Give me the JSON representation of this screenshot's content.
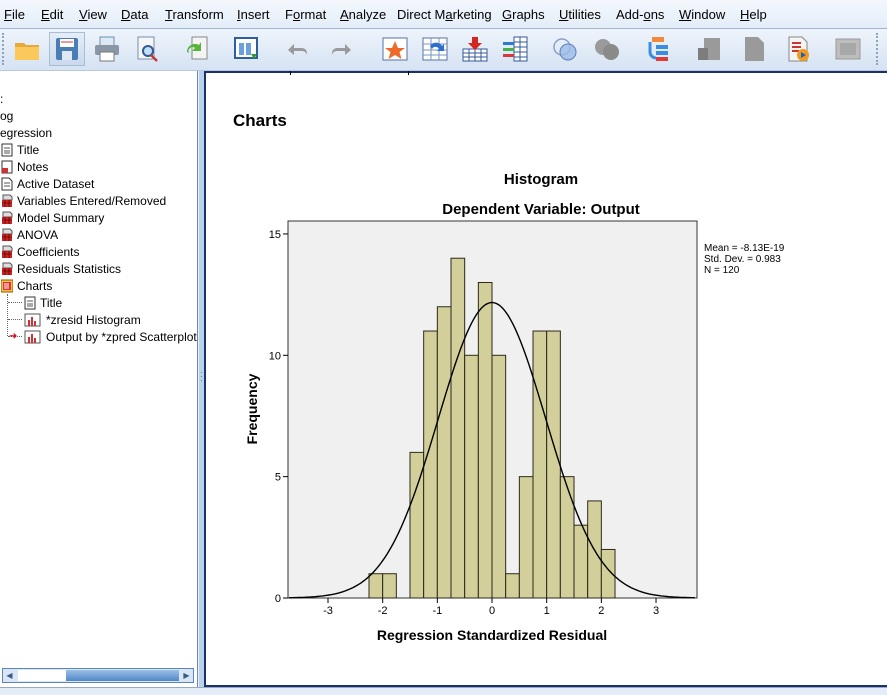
{
  "menu": [
    {
      "label": "File",
      "underline": 0
    },
    {
      "label": "Edit",
      "underline": 0
    },
    {
      "label": "View",
      "underline": 0
    },
    {
      "label": "Data",
      "underline": 0
    },
    {
      "label": "Transform",
      "underline": 0
    },
    {
      "label": "Insert",
      "underline": 0
    },
    {
      "label": "Format",
      "underline": 1
    },
    {
      "label": "Analyze",
      "underline": 0
    },
    {
      "label": "Direct Marketing",
      "underline": 8
    },
    {
      "label": "Graphs",
      "underline": 0
    },
    {
      "label": "Utilities",
      "underline": 0
    },
    {
      "label": "Add-ons",
      "underline": 4
    },
    {
      "label": "Window",
      "underline": 0
    },
    {
      "label": "Help",
      "underline": 0
    }
  ],
  "toolbar": [
    {
      "icon": "open-folder-icon",
      "enabled": true
    },
    {
      "icon": "save-icon",
      "enabled": true,
      "pressed": true
    },
    {
      "icon": "print-icon",
      "enabled": true
    },
    {
      "icon": "print-preview-icon",
      "enabled": true
    },
    {
      "icon": "export-icon",
      "enabled": true
    },
    {
      "icon": "recall-dialog-icon",
      "enabled": true
    },
    {
      "icon": "undo-icon",
      "enabled": false
    },
    {
      "icon": "redo-icon",
      "enabled": false
    },
    {
      "icon": "goto-case-icon",
      "enabled": true
    },
    {
      "icon": "goto-variable-icon",
      "enabled": true
    },
    {
      "icon": "insert-cases-icon",
      "enabled": true
    },
    {
      "icon": "variables-icon",
      "enabled": true
    },
    {
      "icon": "split-file-icon",
      "enabled": true
    },
    {
      "icon": "select-cases-icon",
      "enabled": false
    },
    {
      "icon": "outline-tree-icon",
      "enabled": true
    },
    {
      "icon": "promote-icon",
      "enabled": false
    },
    {
      "icon": "demote-icon",
      "enabled": false
    },
    {
      "icon": "run-script-icon",
      "enabled": true
    },
    {
      "icon": "show-hide-icon",
      "enabled": false
    }
  ],
  "outline": [
    {
      "label": ":",
      "indent": 0,
      "icon": "none"
    },
    {
      "label": "og",
      "indent": 0,
      "icon": "none"
    },
    {
      "label": "egression",
      "indent": 0,
      "icon": "none"
    },
    {
      "label": "Title",
      "indent": 1,
      "icon": "title-icon"
    },
    {
      "label": "Notes",
      "indent": 1,
      "icon": "notes-icon"
    },
    {
      "label": "Active Dataset",
      "indent": 1,
      "icon": "document-icon"
    },
    {
      "label": "Variables Entered/Removed",
      "indent": 1,
      "icon": "table-icon"
    },
    {
      "label": "Model Summary",
      "indent": 1,
      "icon": "table-icon"
    },
    {
      "label": "ANOVA",
      "indent": 1,
      "icon": "table-icon"
    },
    {
      "label": "Coefficients",
      "indent": 1,
      "icon": "table-icon"
    },
    {
      "label": "Residuals Statistics",
      "indent": 1,
      "icon": "table-icon"
    },
    {
      "label": "Charts",
      "indent": 1,
      "icon": "folder-open-icon"
    },
    {
      "label": "Title",
      "indent": 2,
      "icon": "title-icon"
    },
    {
      "label": "*zresid Histogram",
      "indent": 2,
      "icon": "chart-icon"
    },
    {
      "label": "Output by *zpred Scatterplot",
      "indent": 2,
      "icon": "chart-icon",
      "current": true
    }
  ],
  "output": {
    "heading": "Charts"
  },
  "chart_data": {
    "type": "bar",
    "title": "Histogram",
    "subtitle": "Dependent Variable: Output",
    "xlabel": "Regression Standardized Residual",
    "ylabel": "Frequency",
    "xlim": [
      -3.5,
      3.75
    ],
    "ylim": [
      0,
      15.5
    ],
    "xticks": [
      -3,
      -2,
      -1,
      0,
      1,
      2,
      3
    ],
    "yticks": [
      0,
      5,
      10,
      15
    ],
    "bin_width": 0.25,
    "bin_starts": [
      -2.25,
      -2.0,
      -1.75,
      -1.5,
      -1.25,
      -1.0,
      -0.75,
      -0.5,
      -0.25,
      0.0,
      0.25,
      0.5,
      0.75,
      1.0,
      1.25,
      1.5,
      1.75,
      2.0
    ],
    "values": [
      1,
      1,
      0,
      6,
      11,
      12,
      14,
      10,
      13,
      10,
      1,
      5,
      11,
      11,
      5,
      3,
      4,
      2
    ],
    "normal_curve": {
      "mean": -8.13e-19,
      "sd": 0.983,
      "n": 120
    },
    "stats_legend": [
      "Mean = -8.13E-19",
      "Std. Dev. = 0.983",
      "N = 120"
    ],
    "legend_position": "right",
    "bar_color": "#d3cf9a",
    "plot_bg": "#f0f0f0",
    "grid": false
  }
}
